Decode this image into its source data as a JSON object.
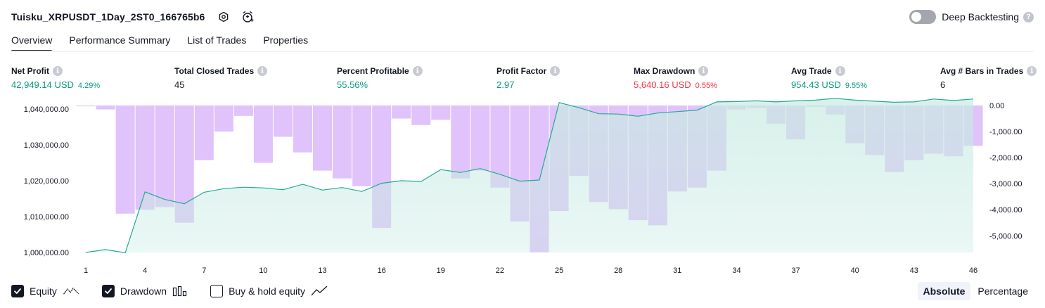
{
  "header": {
    "strategy_title": "Tuisku_XRPUSDT_1Day_2ST0_166765b6",
    "deep_backtesting_label": "Deep Backtesting",
    "help_glyph": "?"
  },
  "tabs": [
    {
      "label": "Overview",
      "active": true
    },
    {
      "label": "Performance Summary",
      "active": false
    },
    {
      "label": "List of Trades",
      "active": false
    },
    {
      "label": "Properties",
      "active": false
    }
  ],
  "info_glyph": "i",
  "metrics": {
    "net_profit": {
      "label": "Net Profit",
      "value": "42,949.14 USD",
      "pct": "4.29%"
    },
    "total_closed_trades": {
      "label": "Total Closed Trades",
      "value": "45"
    },
    "percent_profitable": {
      "label": "Percent Profitable",
      "value": "55.56%"
    },
    "profit_factor": {
      "label": "Profit Factor",
      "value": "2.97"
    },
    "max_drawdown": {
      "label": "Max Drawdown",
      "value": "5,640.16 USD",
      "pct": "0.55%"
    },
    "avg_trade": {
      "label": "Avg Trade",
      "value": "954.43 USD",
      "pct": "9.55%"
    },
    "avg_bars": {
      "label": "Avg # Bars in Trades",
      "value": "6"
    }
  },
  "colors": {
    "green": "#089981",
    "red": "#f23645",
    "drawdown_fill": "#d1a7f8",
    "equity_line": "#22ab94",
    "equity_fill": "#c8ebe2"
  },
  "chart_data": {
    "type": "line",
    "x": [
      1,
      2,
      3,
      4,
      5,
      6,
      7,
      8,
      9,
      10,
      11,
      12,
      13,
      14,
      15,
      16,
      17,
      18,
      19,
      20,
      21,
      22,
      23,
      24,
      25,
      26,
      27,
      28,
      29,
      30,
      31,
      32,
      33,
      34,
      35,
      36,
      37,
      38,
      39,
      40,
      41,
      42,
      43,
      44,
      45,
      46
    ],
    "x_tick_labels": [
      "1",
      "4",
      "7",
      "10",
      "13",
      "16",
      "19",
      "22",
      "25",
      "28",
      "31",
      "34",
      "37",
      "40",
      "43",
      "46"
    ],
    "series": [
      {
        "axis": "left",
        "style": "area-line",
        "values": [
          1000000,
          1000800,
          999900,
          1016900,
          1014800,
          1013600,
          1016800,
          1017800,
          1018200,
          1018000,
          1017500,
          1019000,
          1017400,
          1018100,
          1017000,
          1019300,
          1020000,
          1019800,
          1023100,
          1022300,
          1023400,
          1021800,
          1019900,
          1020200,
          1041800,
          1040400,
          1038700,
          1038600,
          1038000,
          1038900,
          1039300,
          1039700,
          1042000,
          1042100,
          1042300,
          1042000,
          1042300,
          1042500,
          1043000,
          1042500,
          1042200,
          1041900,
          1042000,
          1042800,
          1042400,
          1042800
        ]
      },
      {
        "axis": "right",
        "style": "bar",
        "values": [
          -30,
          -150,
          -4150,
          -4000,
          -3900,
          -4500,
          -2100,
          -1000,
          -400,
          -2200,
          -1200,
          -1800,
          -2500,
          -2800,
          -3100,
          -4700,
          -500,
          -750,
          -550,
          -2800,
          -2500,
          -3150,
          -4450,
          -5640,
          -4050,
          -2700,
          -3700,
          -3980,
          -4400,
          -4600,
          -3300,
          -3150,
          -2500,
          -150,
          -100,
          -700,
          -1300,
          -50,
          -350,
          -1450,
          -1900,
          -2550,
          -2100,
          -1850,
          -1950,
          -1550
        ]
      }
    ],
    "y_left_ticks": [
      "1,000,000.00",
      "1,010,000.00",
      "1,020,000.00",
      "1,030,000.00",
      "1,040,000.00"
    ],
    "y_left_tick_values": [
      1000000,
      1010000,
      1020000,
      1030000,
      1040000
    ],
    "y_left_range": [
      1000000,
      1041000
    ],
    "y_right_ticks": [
      "0.00",
      "-1,000.00",
      "-2,000.00",
      "-3,000.00",
      "-4,000.00",
      "-5,000.00"
    ],
    "y_right_tick_values": [
      0,
      -1000,
      -2000,
      -3000,
      -4000,
      -5000
    ],
    "y_right_range": [
      -5640,
      0
    ],
    "grid": false
  },
  "legend": {
    "equity": {
      "label": "Equity",
      "checked": true
    },
    "drawdown": {
      "label": "Drawdown",
      "checked": true
    },
    "buy_hold": {
      "label": "Buy & hold equity",
      "checked": false
    }
  },
  "mode_toggle": {
    "absolute_label": "Absolute",
    "percentage_label": "Percentage",
    "active": "Absolute"
  }
}
